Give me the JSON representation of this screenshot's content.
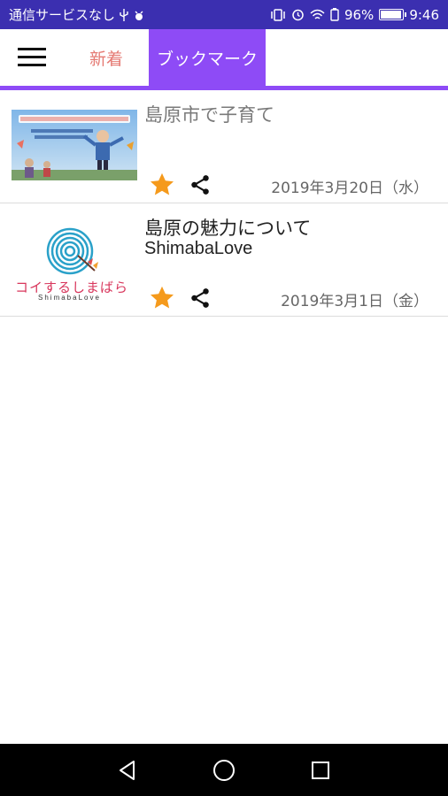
{
  "statusbar": {
    "carrier": "通信サービスなし",
    "battery_percent": "96%",
    "battery_level": 0.96,
    "time": "9:46"
  },
  "appbar": {
    "tabs": [
      {
        "label": "新着",
        "active": false
      },
      {
        "label": "ブックマーク",
        "active": true
      }
    ]
  },
  "items": [
    {
      "title": "島原市で子育て",
      "subtitle": "",
      "date": "2019年3月20日（水）",
      "bookmarked": true,
      "thumbnail": "family-photo"
    },
    {
      "title": "島原の魅力について",
      "subtitle": "ShimabaLove",
      "date": "2019年3月1日（金）",
      "bookmarked": true,
      "thumbnail": "koisuru-shimabara-logo",
      "logo_text": "コイするしまばら",
      "logo_subtext": "ShimabaLove"
    }
  ],
  "colors": {
    "statusbar": "#3b2fb0",
    "accent": "#8e4bf6",
    "star": "#f59a1c",
    "tab_inactive": "#e57a73"
  }
}
